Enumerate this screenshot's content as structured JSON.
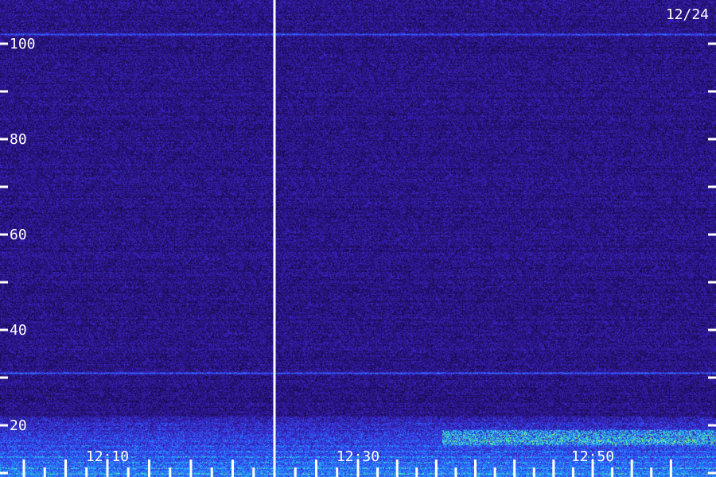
{
  "chart_data": {
    "type": "heatmap",
    "date_label": "12/24",
    "y_ticks": [
      20,
      40,
      60,
      80,
      100
    ],
    "ylim": [
      0,
      110
    ],
    "x_ticks": [
      "12:10",
      "12:30",
      "12:50"
    ],
    "xlim_minutes": [
      12.0,
      72.0
    ],
    "x_tick_minutes": [
      70,
      130,
      190
    ],
    "divider_minute": 110,
    "minor_tick_spacing_minutes": 5,
    "minor_tick_spacing_y": 10,
    "colormap": [
      "#0a0420",
      "#23106a",
      "#3b1fbf",
      "#2f57ff",
      "#1ea8ff",
      "#3fe6c8",
      "#b8ff3a"
    ],
    "bright_lines_y": [
      102,
      31
    ],
    "low_band_y_max": 22
  }
}
